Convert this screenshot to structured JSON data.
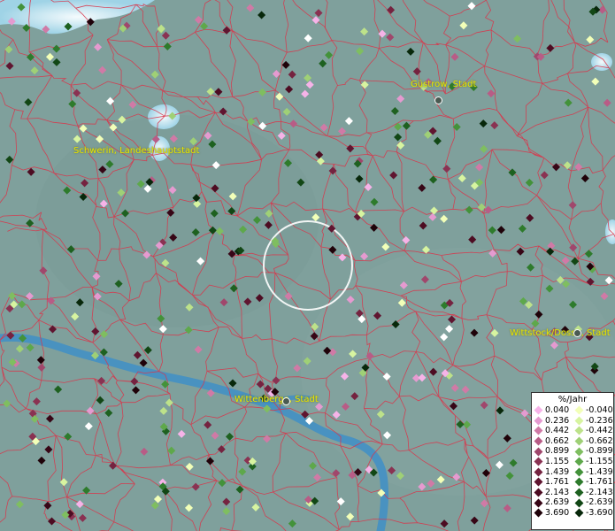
{
  "map": {
    "places": [
      {
        "name": "Güstrow, Stadt"
      },
      {
        "name": "Schwerin, Landeshauptstadt"
      },
      {
        "name": "Wittstock/Dosse, Stadt"
      },
      {
        "name": "Wittenberge, Stadt"
      }
    ],
    "colors": {
      "background": "#7fa09c",
      "borders": "#d8364b",
      "water": "#bde6f2",
      "river": "#3f8fc7"
    }
  },
  "legend": {
    "title": "%/Jahr",
    "positive": [
      "0.040",
      "0.236",
      "0.442",
      "0.662",
      "0.899",
      "1.155",
      "1.439",
      "1.761",
      "2.143",
      "2.639",
      "3.690"
    ],
    "negative": [
      "-0.040",
      "-0.236",
      "-0.442",
      "-0.662",
      "-0.899",
      "-1.155",
      "-1.439",
      "-1.761",
      "-2.143",
      "-2.639",
      "-3.690"
    ],
    "positive_colors": [
      "#f6b3e8",
      "#e59ad0",
      "#d07aa6",
      "#b85c86",
      "#a0476c",
      "#8a3252",
      "#752340",
      "#601530",
      "#4d0c22",
      "#370616",
      "#1f0209"
    ],
    "negative_colors": [
      "#f2ffb8",
      "#d7f4a0",
      "#bde28a",
      "#9fd076",
      "#7fbe60",
      "#5ea84b",
      "#43923a",
      "#2e7b2c",
      "#1e6120",
      "#124715",
      "#08280b"
    ]
  }
}
